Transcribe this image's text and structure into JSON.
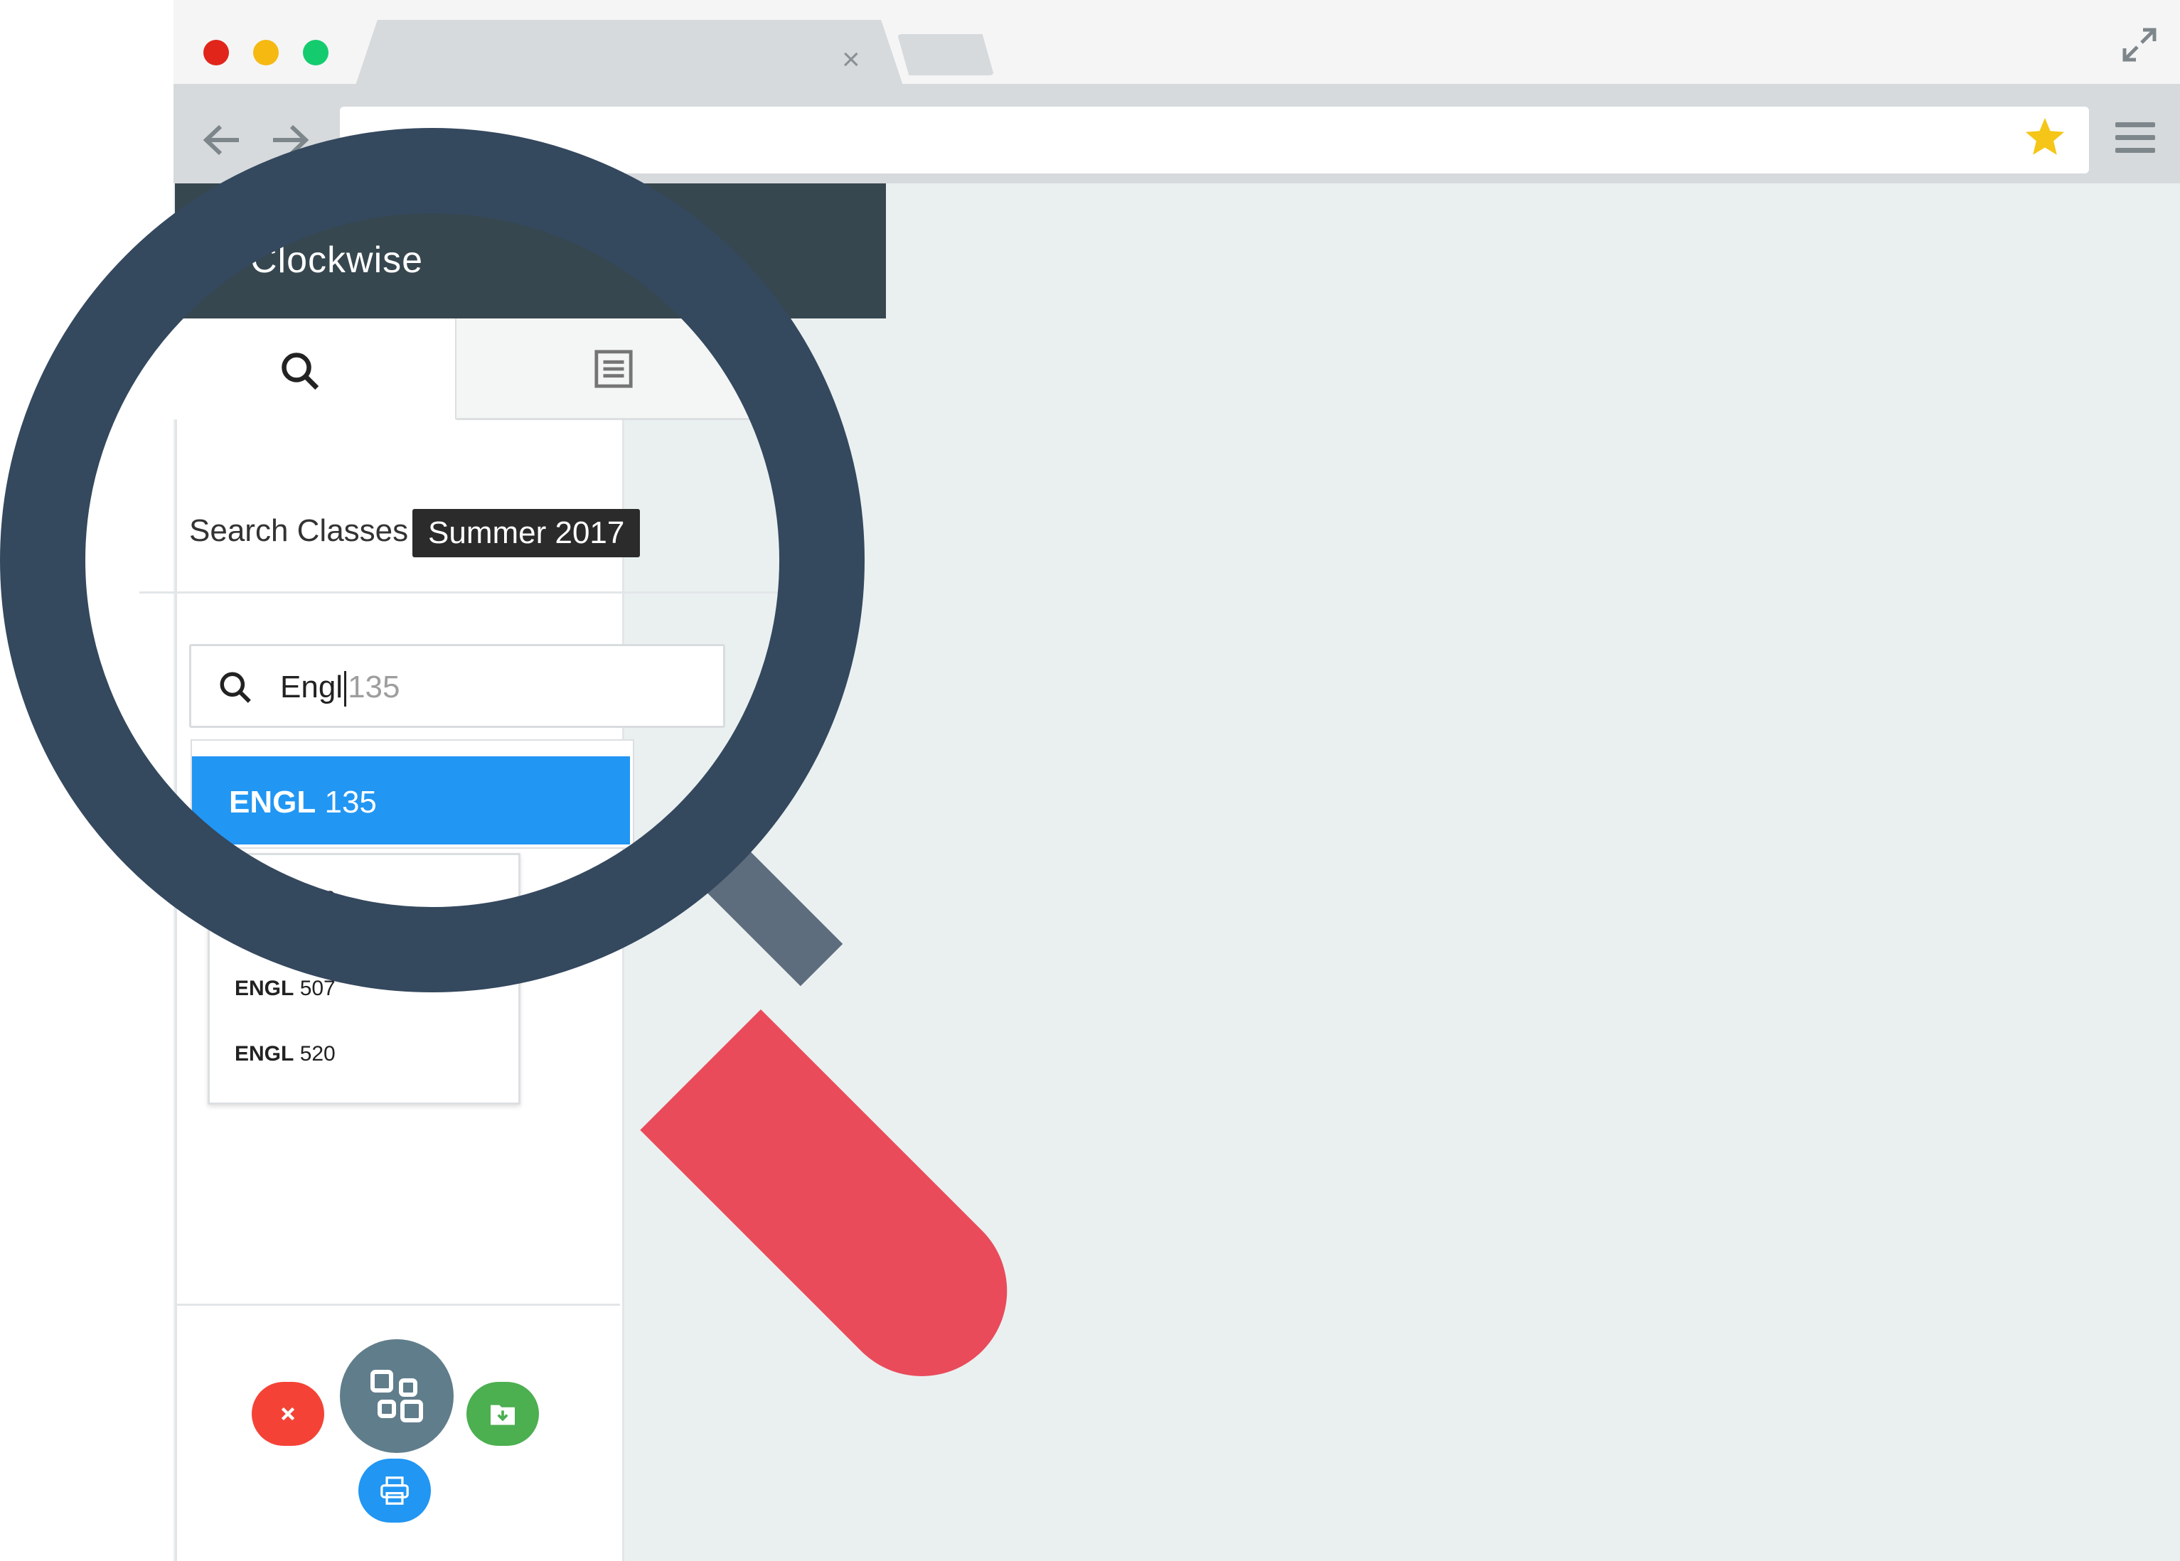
{
  "browser": {
    "traffic_lights": [
      "#e1251b",
      "#f5b912",
      "#14cc6e"
    ],
    "tab_close_glyph": "×",
    "back_icon": "arrow-left-icon",
    "forward_icon": "arrow-right-icon",
    "star_icon": "star-icon",
    "star_color": "#f5c518"
  },
  "app": {
    "brand": "Clockwise",
    "tabs": [
      {
        "icon": "search-icon"
      },
      {
        "icon": "list-icon"
      }
    ],
    "search_label": "Search Classes",
    "term": "Summer 2017",
    "search": {
      "typed": "Engl",
      "autocomplete_hint": "135"
    },
    "dropdown": {
      "selected": {
        "dept": "ENGL",
        "num": "135"
      },
      "items": [
        {
          "dept": "ENGL",
          "num": "146"
        },
        {
          "dept": "ENGL",
          "num": "507"
        },
        {
          "dept": "ENGL",
          "num": "520"
        }
      ]
    },
    "actions": [
      {
        "icon": "close-icon",
        "color": "#f44336"
      },
      {
        "icon": "schedule-icon",
        "color": "#607d8b"
      },
      {
        "icon": "download-icon",
        "color": "#4caf50"
      },
      {
        "icon": "print-icon",
        "color": "#2196f3"
      }
    ]
  },
  "decoration": {
    "magnifier_ring_color": "#34485e",
    "magnifier_handle_color": "#e94b5b"
  }
}
